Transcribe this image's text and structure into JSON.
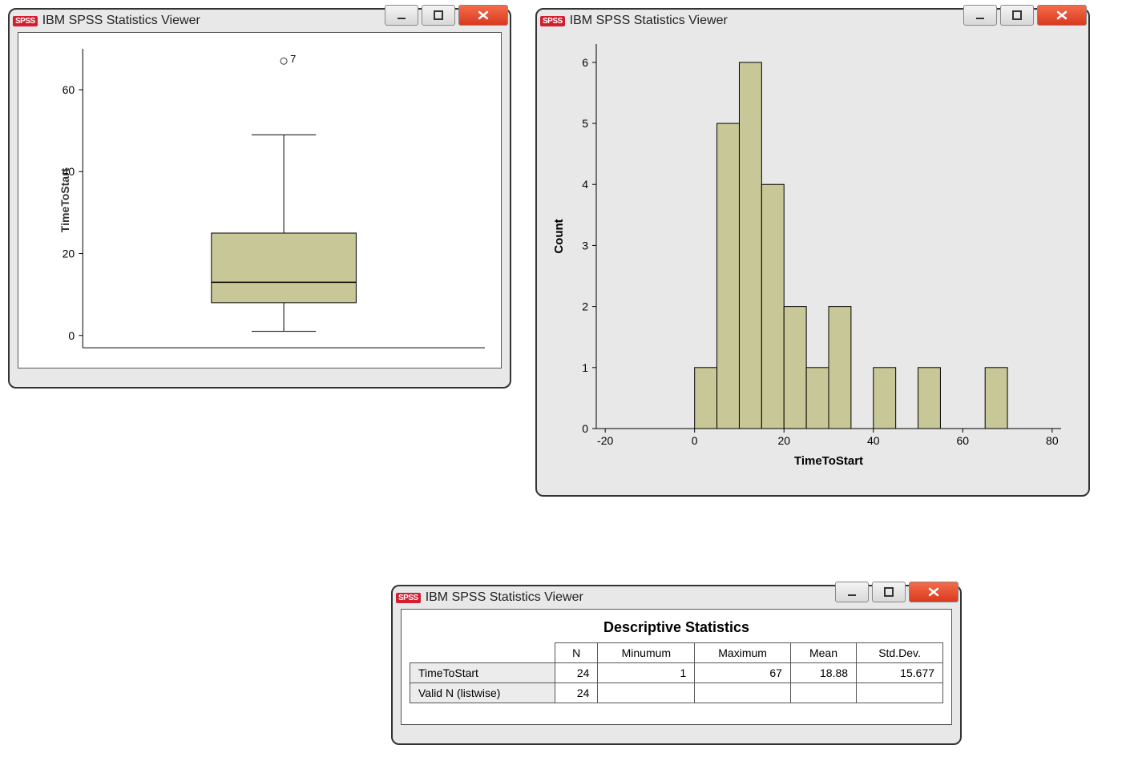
{
  "app_title": "IBM SPSS Statistics Viewer",
  "icon_text": "SPSS",
  "chart_data": [
    {
      "type": "boxplot",
      "ylabel": "TimeToStart",
      "yticks": [
        0,
        20,
        40,
        60
      ],
      "ylim": [
        -3,
        70
      ],
      "box": {
        "min": 1,
        "q1": 8,
        "median": 13,
        "q3": 25,
        "max": 49
      },
      "outliers": [
        {
          "value": 67,
          "label": "7"
        }
      ]
    },
    {
      "type": "bar",
      "xlabel": "TimeToStart",
      "ylabel": "Count",
      "xticks": [
        -20,
        0,
        20,
        40,
        60,
        80
      ],
      "yticks": [
        0,
        1,
        2,
        3,
        4,
        5,
        6
      ],
      "xlim": [
        -22,
        82
      ],
      "ylim": [
        0,
        6.3
      ],
      "bin_width": 5,
      "bars": [
        {
          "x0": 0,
          "count": 1
        },
        {
          "x0": 5,
          "count": 5
        },
        {
          "x0": 10,
          "count": 6
        },
        {
          "x0": 15,
          "count": 4
        },
        {
          "x0": 20,
          "count": 2
        },
        {
          "x0": 25,
          "count": 1
        },
        {
          "x0": 30,
          "count": 2
        },
        {
          "x0": 40,
          "count": 1
        },
        {
          "x0": 50,
          "count": 1
        },
        {
          "x0": 65,
          "count": 1
        }
      ]
    },
    {
      "type": "table",
      "title": "Descriptive Statistics",
      "columns": [
        "",
        "N",
        "Minumum",
        "Maximum",
        "Mean",
        "Std.Dev."
      ],
      "rows": [
        {
          "label": "TimeToStart",
          "values": [
            "24",
            "1",
            "67",
            "18.88",
            "15.677"
          ]
        },
        {
          "label": "Valid N (listwise)",
          "values": [
            "24",
            "",
            "",
            "",
            ""
          ]
        }
      ]
    }
  ]
}
